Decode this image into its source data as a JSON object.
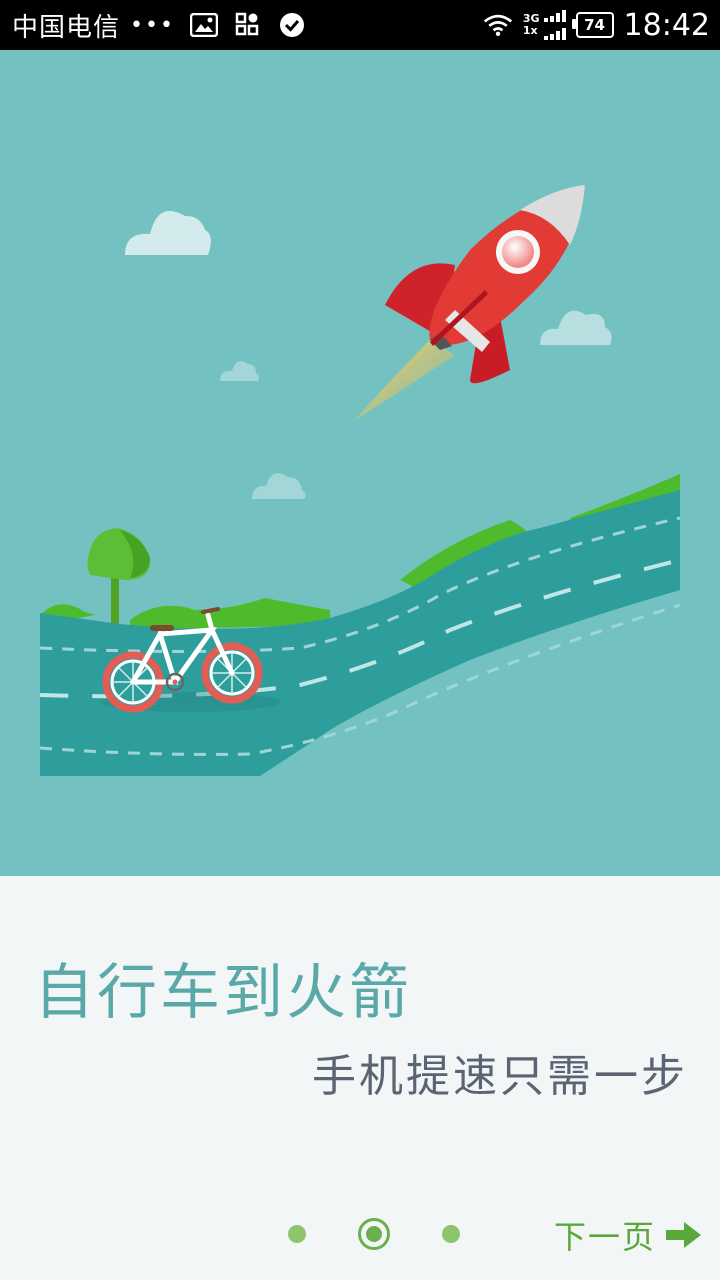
{
  "status_bar": {
    "carrier": "中国电信",
    "more_indicator": "•••",
    "network_top": "3G",
    "network_bottom": "1x",
    "battery": "74",
    "time": "18:42"
  },
  "onboarding": {
    "title": "自行车到火箭",
    "subtitle": "手机提速只需一步",
    "next_label": "下一页",
    "page_index": 2,
    "page_count": 3
  },
  "colors": {
    "sky": "#73c2c1",
    "road": "#2e9e9d",
    "grass": "#4dbb2c",
    "accent_green": "#6ab04c",
    "title_color": "#5aa9a8"
  },
  "icons": [
    "image-icon",
    "apps-icon",
    "check-circle-icon",
    "wifi-icon",
    "signal-icon",
    "battery-icon",
    "arrow-right-icon",
    "rocket-icon",
    "bicycle-icon",
    "tree-icon",
    "cloud-icon"
  ]
}
